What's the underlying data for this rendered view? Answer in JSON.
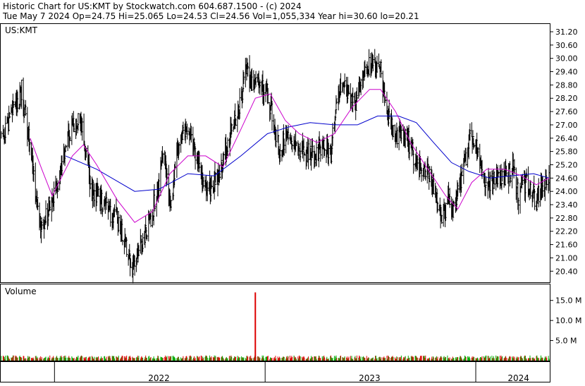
{
  "header": {
    "line1": "Historic Chart for US:KMT by Stockwatch.com 604.687.1500 - (c) 2024",
    "line2": "Tue May  7 2024   Op=24.75   Hi=25.065   Lo=24.53   Cl=24.56   Vol=1,055,334   Year hi=30.60   lo=20.21"
  },
  "chart_data": {
    "type": "line",
    "symbol": "US:KMT",
    "price_panel_label": "US:KMT",
    "volume_panel_label": "Volume",
    "price_ticks": [
      "31.20",
      "30.60",
      "30.00",
      "29.40",
      "28.80",
      "28.20",
      "27.60",
      "27.00",
      "26.40",
      "25.80",
      "25.20",
      "24.60",
      "24.00",
      "23.40",
      "22.80",
      "22.20",
      "21.60",
      "21.00",
      "20.40"
    ],
    "price_ylim": [
      19.9,
      31.55
    ],
    "volume_ticks": [
      "15.0 M",
      "10.0 M",
      "5.0 M"
    ],
    "volume_ylim": [
      0,
      19
    ],
    "x_labels": [
      "2022",
      "2023",
      "2024"
    ],
    "x_range": [
      "2021-10-01",
      "2024-05-07"
    ],
    "year_dividers": [
      "2022-01-01",
      "2023-01-01",
      "2024-01-01"
    ],
    "x_label_dates": [
      "2022-07-01",
      "2023-07-01",
      "2024-03-15"
    ],
    "bar_color": "#000000",
    "ma_short_color": "#cc00cc",
    "ma_long_color": "#0000cc",
    "volume_up_color": "#00aa00",
    "volume_down_color": "#dd0000",
    "volume_spike_color": "#dd0000",
    "grid": false,
    "price_points": [
      {
        "x": "2021-10-01",
        "y": 26.4
      },
      {
        "x": "2021-10-20",
        "y": 27.6
      },
      {
        "x": "2021-11-05",
        "y": 28.6
      },
      {
        "x": "2021-11-20",
        "y": 26.0
      },
      {
        "x": "2021-12-01",
        "y": 23.4
      },
      {
        "x": "2021-12-10",
        "y": 22.2
      },
      {
        "x": "2021-12-22",
        "y": 23.3
      },
      {
        "x": "2022-01-10",
        "y": 24.6
      },
      {
        "x": "2022-01-25",
        "y": 26.4
      },
      {
        "x": "2022-02-10",
        "y": 27.3
      },
      {
        "x": "2022-02-20",
        "y": 26.6
      },
      {
        "x": "2022-03-05",
        "y": 24.2
      },
      {
        "x": "2022-03-20",
        "y": 23.6
      },
      {
        "x": "2022-04-05",
        "y": 23.1
      },
      {
        "x": "2022-04-20",
        "y": 22.7
      },
      {
        "x": "2022-05-05",
        "y": 21.6
      },
      {
        "x": "2022-05-15",
        "y": 20.6
      },
      {
        "x": "2022-05-30",
        "y": 21.7
      },
      {
        "x": "2022-06-15",
        "y": 22.6
      },
      {
        "x": "2022-07-01",
        "y": 24.4
      },
      {
        "x": "2022-07-10",
        "y": 25.8
      },
      {
        "x": "2022-07-20",
        "y": 23.2
      },
      {
        "x": "2022-08-05",
        "y": 26.4
      },
      {
        "x": "2022-08-20",
        "y": 26.8
      },
      {
        "x": "2022-09-05",
        "y": 25.4
      },
      {
        "x": "2022-09-20",
        "y": 24.0
      },
      {
        "x": "2022-10-05",
        "y": 24.4
      },
      {
        "x": "2022-10-20",
        "y": 25.4
      },
      {
        "x": "2022-11-05",
        "y": 26.8
      },
      {
        "x": "2022-11-20",
        "y": 28.0
      },
      {
        "x": "2022-12-01",
        "y": 29.8
      },
      {
        "x": "2022-12-10",
        "y": 28.6
      },
      {
        "x": "2022-12-22",
        "y": 28.8
      },
      {
        "x": "2023-01-05",
        "y": 28.4
      },
      {
        "x": "2023-01-15",
        "y": 27.2
      },
      {
        "x": "2023-01-25",
        "y": 25.8
      },
      {
        "x": "2023-02-10",
        "y": 26.8
      },
      {
        "x": "2023-02-25",
        "y": 26.0
      },
      {
        "x": "2023-03-10",
        "y": 25.8
      },
      {
        "x": "2023-03-25",
        "y": 25.6
      },
      {
        "x": "2023-04-10",
        "y": 26.2
      },
      {
        "x": "2023-04-25",
        "y": 25.6
      },
      {
        "x": "2023-05-05",
        "y": 28.4
      },
      {
        "x": "2023-05-20",
        "y": 28.6
      },
      {
        "x": "2023-06-05",
        "y": 27.8
      },
      {
        "x": "2023-06-20",
        "y": 29.6
      },
      {
        "x": "2023-07-05",
        "y": 29.8
      },
      {
        "x": "2023-07-20",
        "y": 29.4
      },
      {
        "x": "2023-08-01",
        "y": 27.4
      },
      {
        "x": "2023-08-15",
        "y": 26.4
      },
      {
        "x": "2023-09-01",
        "y": 26.6
      },
      {
        "x": "2023-09-15",
        "y": 25.6
      },
      {
        "x": "2023-10-01",
        "y": 25.0
      },
      {
        "x": "2023-10-15",
        "y": 24.6
      },
      {
        "x": "2023-10-28",
        "y": 23.2
      },
      {
        "x": "2023-11-05",
        "y": 22.6
      },
      {
        "x": "2023-11-15",
        "y": 23.8
      },
      {
        "x": "2023-11-25",
        "y": 23.0
      },
      {
        "x": "2023-12-01",
        "y": 24.0
      },
      {
        "x": "2023-12-10",
        "y": 24.8
      },
      {
        "x": "2023-12-20",
        "y": 26.4
      },
      {
        "x": "2024-01-01",
        "y": 26.0
      },
      {
        "x": "2024-01-10",
        "y": 24.8
      },
      {
        "x": "2024-01-25",
        "y": 24.4
      },
      {
        "x": "2024-02-05",
        "y": 24.8
      },
      {
        "x": "2024-02-20",
        "y": 24.6
      },
      {
        "x": "2024-03-05",
        "y": 25.0
      },
      {
        "x": "2024-03-15",
        "y": 23.8
      },
      {
        "x": "2024-03-25",
        "y": 24.4
      },
      {
        "x": "2024-04-05",
        "y": 24.2
      },
      {
        "x": "2024-04-15",
        "y": 23.6
      },
      {
        "x": "2024-04-25",
        "y": 24.2
      },
      {
        "x": "2024-05-07",
        "y": 24.56
      }
    ],
    "ma_short": [
      {
        "x": "2021-11-20",
        "y": 26.4
      },
      {
        "x": "2021-12-10",
        "y": 25.0
      },
      {
        "x": "2021-12-28",
        "y": 23.8
      },
      {
        "x": "2022-02-01",
        "y": 25.6
      },
      {
        "x": "2022-02-20",
        "y": 26.1
      },
      {
        "x": "2022-03-15",
        "y": 25.2
      },
      {
        "x": "2022-04-20",
        "y": 23.6
      },
      {
        "x": "2022-05-20",
        "y": 22.6
      },
      {
        "x": "2022-06-20",
        "y": 23.1
      },
      {
        "x": "2022-07-20",
        "y": 24.8
      },
      {
        "x": "2022-08-20",
        "y": 25.6
      },
      {
        "x": "2022-09-20",
        "y": 25.6
      },
      {
        "x": "2022-10-20",
        "y": 25.1
      },
      {
        "x": "2022-11-20",
        "y": 26.8
      },
      {
        "x": "2022-12-15",
        "y": 28.2
      },
      {
        "x": "2023-01-10",
        "y": 28.4
      },
      {
        "x": "2023-02-05",
        "y": 27.2
      },
      {
        "x": "2023-03-01",
        "y": 26.6
      },
      {
        "x": "2023-04-01",
        "y": 26.2
      },
      {
        "x": "2023-05-01",
        "y": 26.6
      },
      {
        "x": "2023-06-01",
        "y": 27.8
      },
      {
        "x": "2023-07-01",
        "y": 28.6
      },
      {
        "x": "2023-07-20",
        "y": 28.6
      },
      {
        "x": "2023-08-15",
        "y": 27.6
      },
      {
        "x": "2023-09-10",
        "y": 26.2
      },
      {
        "x": "2023-10-10",
        "y": 25.0
      },
      {
        "x": "2023-11-10",
        "y": 23.8
      },
      {
        "x": "2023-12-01",
        "y": 23.2
      },
      {
        "x": "2023-12-25",
        "y": 24.4
      },
      {
        "x": "2024-01-20",
        "y": 25.0
      },
      {
        "x": "2024-02-20",
        "y": 25.0
      },
      {
        "x": "2024-03-20",
        "y": 24.7
      },
      {
        "x": "2024-04-15",
        "y": 24.3
      },
      {
        "x": "2024-05-07",
        "y": 24.6
      }
    ],
    "ma_long": [
      {
        "x": "2022-01-20",
        "y": 25.6
      },
      {
        "x": "2022-03-15",
        "y": 25.0
      },
      {
        "x": "2022-05-20",
        "y": 24.0
      },
      {
        "x": "2022-07-01",
        "y": 24.1
      },
      {
        "x": "2022-08-20",
        "y": 24.8
      },
      {
        "x": "2022-10-05",
        "y": 24.7
      },
      {
        "x": "2022-11-20",
        "y": 25.6
      },
      {
        "x": "2023-01-05",
        "y": 26.6
      },
      {
        "x": "2023-02-10",
        "y": 26.9
      },
      {
        "x": "2023-03-20",
        "y": 27.1
      },
      {
        "x": "2023-05-01",
        "y": 27.0
      },
      {
        "x": "2023-06-10",
        "y": 27.0
      },
      {
        "x": "2023-07-15",
        "y": 27.4
      },
      {
        "x": "2023-08-20",
        "y": 27.4
      },
      {
        "x": "2023-09-20",
        "y": 27.1
      },
      {
        "x": "2023-10-20",
        "y": 26.2
      },
      {
        "x": "2023-11-20",
        "y": 25.3
      },
      {
        "x": "2023-12-20",
        "y": 24.9
      },
      {
        "x": "2024-01-25",
        "y": 24.6
      },
      {
        "x": "2024-03-01",
        "y": 24.7
      },
      {
        "x": "2024-04-10",
        "y": 24.8
      },
      {
        "x": "2024-05-07",
        "y": 24.6
      }
    ],
    "volume_spike": {
      "x": "2022-12-15",
      "y": 17.0
    },
    "volume_baseline_millions": 0.8
  }
}
